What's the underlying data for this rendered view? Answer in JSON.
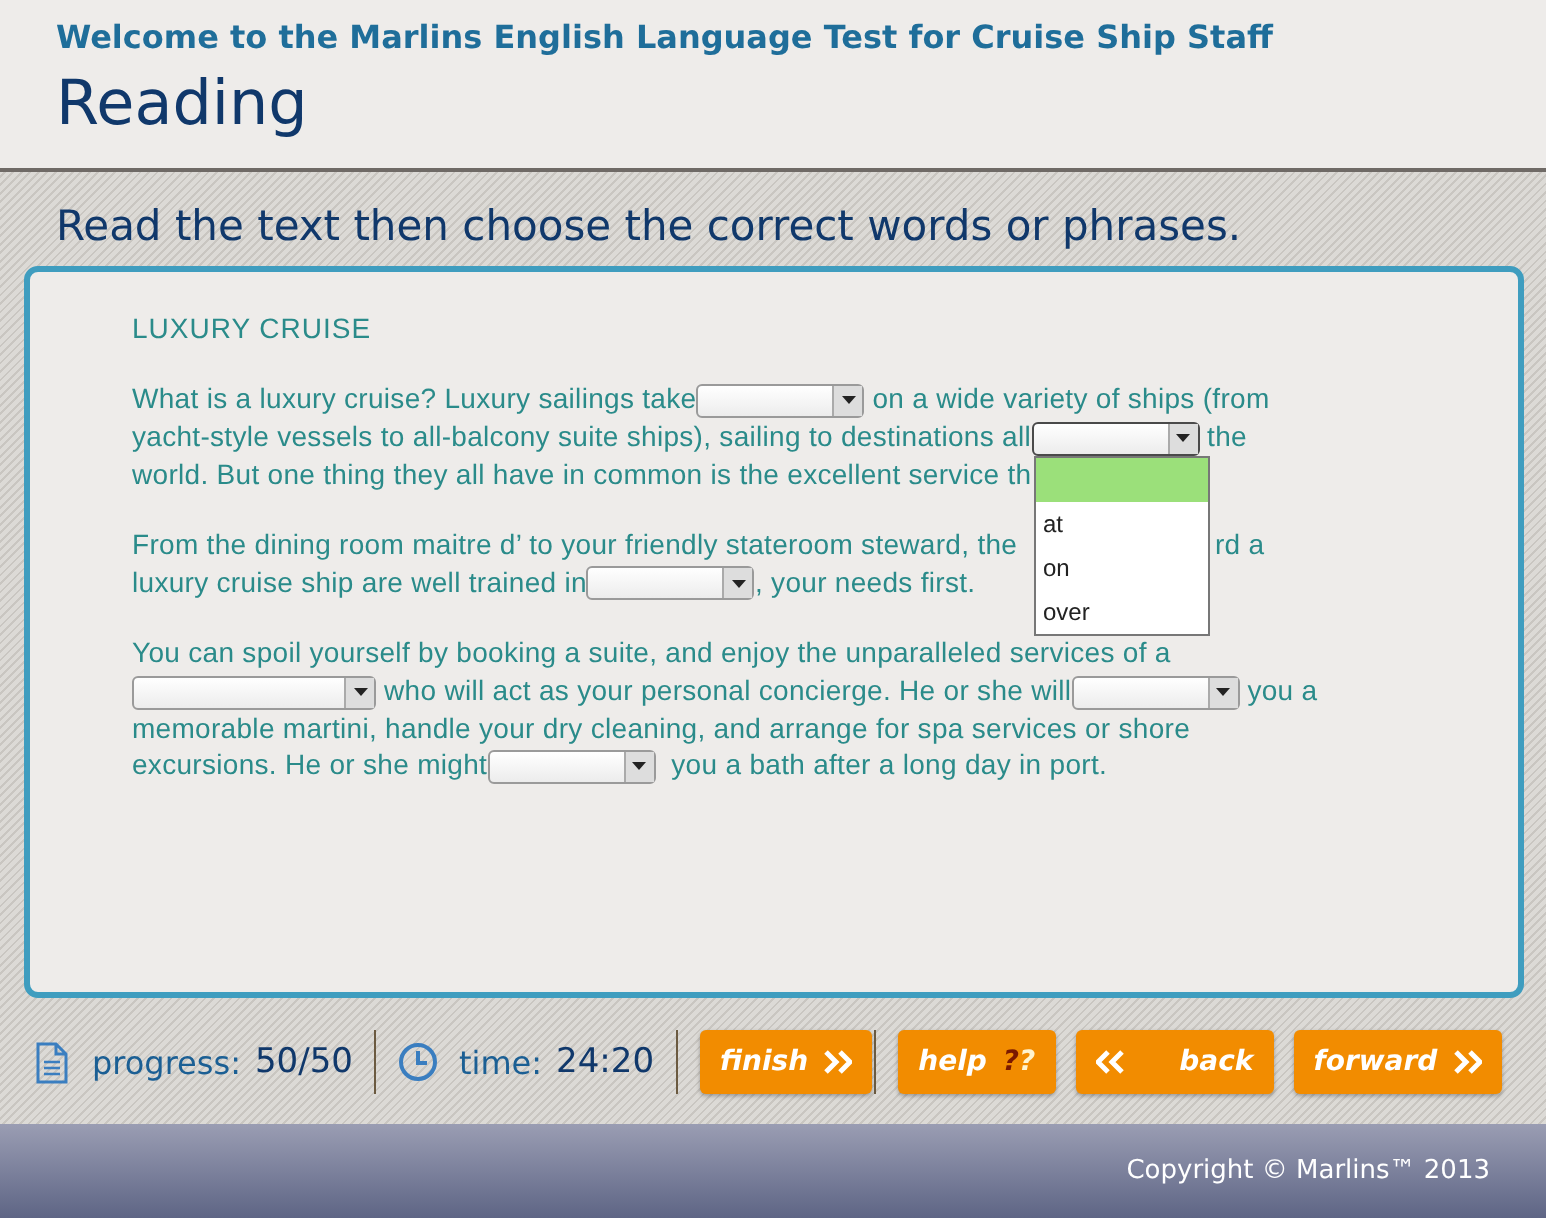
{
  "header": {
    "subtitle": "Welcome to the Marlins English Language Test for Cruise Ship Staff",
    "title": "Reading"
  },
  "instruction": "Read the text then choose the correct words or phrases.",
  "passage": {
    "heading": "LUXURY CRUISE",
    "paragraphs": [
      {
        "segments": [
          {
            "kind": "text",
            "text": "What is a luxury cruise? Luxury sailings take"
          },
          {
            "kind": "select",
            "open": false
          },
          {
            "kind": "text",
            "text": " on a wide variety of ships (from"
          },
          {
            "kind": "break"
          },
          {
            "kind": "text",
            "text": "yacht-style vessels to all-balcony suite ships), sailing to destinations all"
          },
          {
            "kind": "select",
            "open": true,
            "options": [
              {
                "selected": true
              },
              {
                "label": "at",
                "selected": false
              },
              {
                "label": "on",
                "selected": false
              },
              {
                "label": "over",
                "selected": false
              }
            ]
          },
          {
            "kind": "text",
            "text": " the"
          },
          {
            "kind": "break"
          },
          {
            "kind": "text",
            "text": "world. But one thing they all have in common is the excellent service th"
          }
        ]
      },
      {
        "segments": [
          {
            "kind": "text",
            "text": "From the dining room maitre d’ to your friendly stateroom steward, the"
          },
          {
            "kind": "covered"
          },
          {
            "kind": "text",
            "text": "rd a"
          },
          {
            "kind": "break"
          },
          {
            "kind": "text",
            "text": "luxury cruise ship are well trained in"
          },
          {
            "kind": "select",
            "open": false
          },
          {
            "kind": "text",
            "text": ", your needs first."
          }
        ]
      },
      {
        "segments": [
          {
            "kind": "text",
            "text": "You can spoil yourself by booking a suite, and enjoy the unparalleled services of a"
          },
          {
            "kind": "break"
          },
          {
            "kind": "select",
            "open": false
          },
          {
            "kind": "text",
            "text": " who will act as your personal concierge. He or she will"
          },
          {
            "kind": "select",
            "open": false
          },
          {
            "kind": "text",
            "text": " you a"
          },
          {
            "kind": "break"
          },
          {
            "kind": "text",
            "text": "memorable martini, handle your dry cleaning, and arrange for spa services or shore"
          },
          {
            "kind": "break"
          },
          {
            "kind": "text",
            "text": "excursions. He or she might"
          },
          {
            "kind": "select",
            "open": false
          },
          {
            "kind": "text",
            "text": "  you a bath after a long day in port."
          }
        ]
      }
    ]
  },
  "toolbar": {
    "progress_label": "progress:",
    "progress_value": "50/50",
    "time_label": "time:",
    "time_value": "24:20",
    "buttons": [
      {
        "kind": "finish",
        "label": "finish"
      },
      {
        "kind": "help",
        "label": "help",
        "marks": "??"
      },
      {
        "kind": "back",
        "label": "back"
      },
      {
        "kind": "forward",
        "label": "forward"
      }
    ]
  },
  "footer": {
    "copyright": "Copyright © Marlins™ 2013"
  }
}
